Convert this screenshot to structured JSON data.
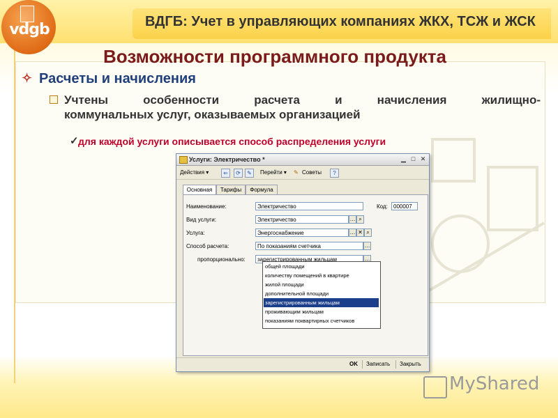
{
  "header": {
    "title": "ВДГБ: Учет в управляющих компаниях ЖКХ, ТСЖ и ЖСК",
    "logo_text": "vdgb"
  },
  "slide": {
    "main_title": "Возможности программного продукта",
    "bullet1": "Расчеты и начисления",
    "bullet2_line1": "Учтены особенности расчета и начисления жилищно-",
    "bullet2_line2": "коммунальных услуг, оказываемых организацией",
    "check_text": "для каждой услуги описывается  способ распределения услуги"
  },
  "window": {
    "title": "Услуги: Электричество *",
    "toolbar": {
      "actions": "Действия ▾",
      "goto": "Перейти ▾",
      "tips": "Советы",
      "help": "?"
    },
    "tabs": [
      "Основная",
      "Тарифы",
      "Формула"
    ],
    "form": {
      "name_label": "Наименование:",
      "name_value": "Электричество",
      "code_label": "Код:",
      "code_value": "000007",
      "service_type_label": "Вид услуги:",
      "service_type_value": "Электричество",
      "service_label": "Услуга:",
      "service_value": "Энергоснабжение",
      "calc_method_label": "Способ расчета:",
      "calc_method_value": "По показаниям счетчика",
      "proportional_label": "пропорционально:",
      "proportional_value": "зарегистрированным жильцам"
    },
    "dropdown_options": [
      "общей площади",
      "количеству помещений в квартире",
      "жилой площади",
      "дополнительной площади",
      "зарегистрированным жильцам",
      "проживающим жильцам",
      "показаниям поквартирных счетчиков"
    ],
    "selected_option": "зарегистрированным жильцам",
    "buttons": {
      "ok": "OK",
      "write": "Записать",
      "close": "Закрыть"
    }
  },
  "watermark": "MyShared",
  "colors": {
    "title_band": "#fbd24a",
    "main_title": "#7a1a1a",
    "bullet_blue": "#1f3f7a",
    "check_red": "#c0002a",
    "selection": "#1c3f8c"
  }
}
